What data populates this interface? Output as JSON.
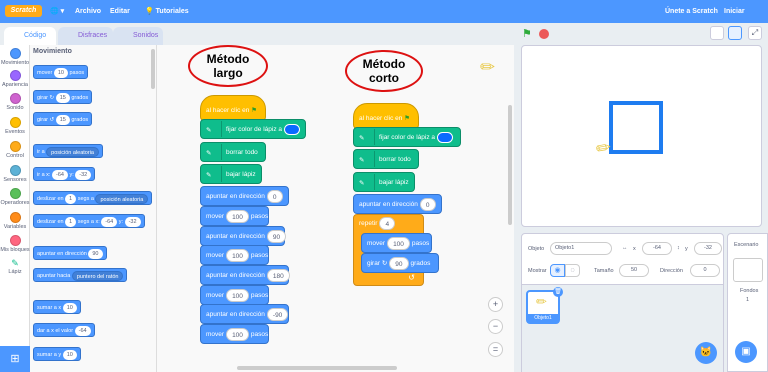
{
  "menubar": {
    "logo": "Scratch",
    "file": "Archivo",
    "edit": "Editar",
    "tutorials": "Tutoriales",
    "join": "Únete a Scratch",
    "signin": "Iniciar sesión"
  },
  "tabs": {
    "code": "Código",
    "costumes": "Disfraces",
    "sounds": "Sonidos"
  },
  "categories": [
    {
      "label": "Movimiento",
      "color": "#4c97ff"
    },
    {
      "label": "Apariencia",
      "color": "#9966ff"
    },
    {
      "label": "Sonido",
      "color": "#cf63cf"
    },
    {
      "label": "Eventos",
      "color": "#ffbf00"
    },
    {
      "label": "Control",
      "color": "#ffab19"
    },
    {
      "label": "Sensores",
      "color": "#5cb1d6"
    },
    {
      "label": "Operadores",
      "color": "#59c059"
    },
    {
      "label": "Variables",
      "color": "#ff8c1a"
    },
    {
      "label": "Mis bloques",
      "color": "#ff6680"
    },
    {
      "label": "Lápiz",
      "color": "#0fbd8c"
    }
  ],
  "palette": {
    "title": "Movimiento",
    "move": {
      "pre": "mover",
      "val": "10",
      "post": "pasos"
    },
    "turn_right": {
      "pre": "girar",
      "val": "15",
      "post": "grados"
    },
    "turn_left": {
      "pre": "girar",
      "val": "15",
      "post": "grados"
    },
    "goto": {
      "pre": "ir a",
      "val": "posición aleatoria"
    },
    "gotoxy": {
      "x": "-64",
      "y": "-32",
      "xl": "ir a x:",
      "yl": "y:"
    },
    "glide_to": {
      "pre": "deslizar en",
      "val": "1",
      "mid": "segs a",
      "dd": "posición aleatoria"
    },
    "glide_xy": {
      "pre": "deslizar en",
      "val": "1",
      "mid": "segs a x:",
      "x": "-64",
      "yl": "y:",
      "y": "-32"
    },
    "point_dir": {
      "pre": "apuntar en dirección",
      "val": "90"
    },
    "point_towards": {
      "pre": "apuntar hacia",
      "val": "puntero del ratón"
    },
    "change_x": {
      "pre": "sumar a x",
      "val": "10"
    },
    "set_x": {
      "pre": "dar a x el valor",
      "val": "-64"
    },
    "change_y": {
      "pre": "sumar a y",
      "val": "10"
    }
  },
  "workspace": {
    "label_long": {
      "l1": "Método",
      "l2": "largo"
    },
    "label_short": {
      "l1": "Método",
      "l2": "corto"
    },
    "long": {
      "hat": "al hacer clic en",
      "pen_color": "fijar color de lápiz a",
      "clear": "borrar todo",
      "pen_down": "bajar lápiz",
      "point": "apuntar en dirección",
      "point_val": "0",
      "move": "mover",
      "steps": "pasos",
      "dirs": [
        "90",
        "180",
        "-90"
      ],
      "move_val": "100"
    },
    "short": {
      "hat": "al hacer clic en",
      "pen_color": "fijar color de lápiz a",
      "clear": "borrar todo",
      "pen_down": "bajar lápiz",
      "point": "apuntar en dirección",
      "point_val": "0",
      "repeat": "repetir",
      "repeat_val": "4",
      "move": "mover",
      "move_val": "100",
      "steps": "pasos",
      "turn": "girar",
      "turn_val": "90",
      "degrees": "grados"
    },
    "zoom_in": "+",
    "zoom_out": "−",
    "zoom_reset": "="
  },
  "sprite_info": {
    "sprite_label": "Objeto",
    "sprite_name": "Objeto1",
    "x_label": "x",
    "x_val": "-64",
    "y_label": "y",
    "y_val": "-32",
    "show_label": "Mostrar",
    "size_label": "Tamaño",
    "size_val": "50",
    "dir_label": "Dirección",
    "dir_val": "0",
    "thumb_label": "Objeto1"
  },
  "stage_pane": {
    "title": "Escenario",
    "backdrops_label": "Fondos",
    "backdrops_count": "1"
  },
  "colors": {
    "accent": "#4c97ff",
    "pen_color": "#0a6bff",
    "stage_square": "#1e7cf0"
  }
}
